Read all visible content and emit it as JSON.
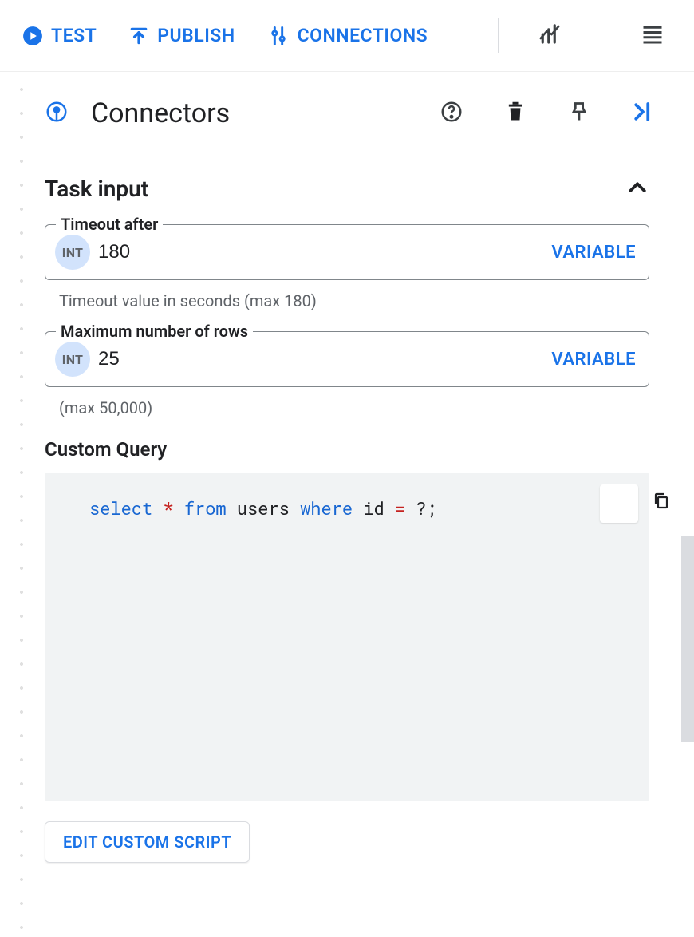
{
  "toolbar": {
    "test_label": "TEST",
    "publish_label": "PUBLISH",
    "connections_label": "CONNECTIONS"
  },
  "panel": {
    "title": "Connectors"
  },
  "section": {
    "title": "Task input"
  },
  "fields": {
    "timeout": {
      "label": "Timeout after",
      "badge": "INT",
      "value": "180",
      "variable_label": "VARIABLE",
      "hint": "Timeout value in seconds (max 180)"
    },
    "max_rows": {
      "label": "Maximum number of rows",
      "badge": "INT",
      "value": "25",
      "variable_label": "VARIABLE",
      "hint": "(max 50,000)"
    }
  },
  "custom_query": {
    "label": "Custom Query",
    "tokens": {
      "select": "select",
      "star": "*",
      "from": "from",
      "users": "users",
      "where": "where",
      "id": "id",
      "eq": "=",
      "q": "?",
      "semi": ";"
    },
    "raw": "select * from users where id = ?;"
  },
  "edit_script_label": "EDIT CUSTOM SCRIPT"
}
